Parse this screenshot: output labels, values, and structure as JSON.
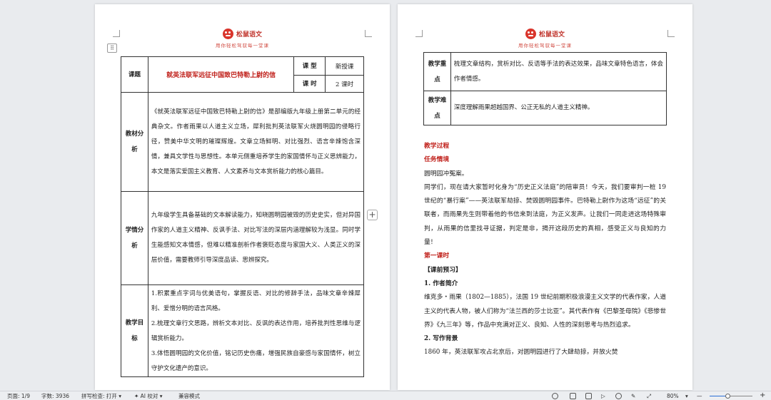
{
  "brand": {
    "name": "松鼠语文",
    "slogan": "用你轻松驾驭每一堂课"
  },
  "page1": {
    "title_label": "课题",
    "title": "就英法联军远征中国致巴特勒上尉的信",
    "type_label": "课 型",
    "type_value": "新授课",
    "hours_label": "课 时",
    "hours_value": "2 课时",
    "rows": [
      {
        "label_line1": "教材分",
        "label_line2": "析",
        "text": "《就英法联军远征中国致巴特勒上尉的信》是部编版九年级上册第二单元的经典杂文。作者雨果以人道主义立场，犀利批判英法联军火烧圆明园的侵略行径，赞美中华文明的璀璨辉煌。文章立场鲜明、对比强烈、语言辛辣饱含深情，兼具文学性与思想性。本单元侧重培养学生的家国情怀与正义思辨能力，本文是落实爱国主义教育、人文素养与文本赏析能力的核心篇目。"
      },
      {
        "label_line1": "学情分",
        "label_line2": "析",
        "text": "九年级学生具备基础的文本解读能力，知晓圆明园被毁的历史史实，但对异国作家的人道主义精神、反讽手法、对比写法的深层内涵理解较为浅显。同时学生能感知文本情感，但难以精准剖析作者褒贬态度与家国大义、人类正义的深层价值，需要教师引导深度品读、思辨探究。"
      },
      {
        "label_line1": "教学目",
        "label_line2": "标",
        "items": [
          "1.积累重点字词与优美语句，掌握反语、对比的修辞手法，品味文章辛辣犀利、爱憎分明的语言风格。",
          "2.梳理文章行文思路，辨析文本对比、反讽的表达作用，培养批判性思维与逻辑赏析能力。",
          "3.体悟圆明园的文化价值，铭记历史伤痛，增强民族自豪感与家国情怀，树立守护文化遗产的意识。"
        ]
      }
    ]
  },
  "page2": {
    "rows": [
      {
        "label_line1": "教学重",
        "label_line2": "点",
        "text": "梳理文章结构，赏析对比、反语等手法的表达效果，品味文章特色语言，体会作者情感。"
      },
      {
        "label_line1": "教学难",
        "label_line2": "点",
        "text": "深度理解雨果超越国界、公正无私的人道主义精神。"
      }
    ],
    "process_title": "教学过程",
    "task_heading": "任务情境",
    "task_subtitle": "圆明园冲冤案。",
    "task_text": "同学们，现在请大家暂时化身为“历史正义法庭”的陪审员！今天，我们要审判一桩 19 世纪的“暴行案”——英法联军劫掠、焚毁圆明园事件。巴特勒上尉作为这场“远征”的关联者，而雨果先生则带着他的书信来到法庭，为正义发声。让我们一同走进这场特殊审判，从雨果的信里找寻证据，判定是非，揭开这段历史的真相，感受正义与良知的力量！",
    "lesson1_title": "第一课时",
    "preview_heading": "【课前预习】",
    "author_heading": "1. 作者简介",
    "author_text": "维克多・雨果（1802—1885），法国 19 世纪前期积极浪漫主义文学的代表作家，人道主义的代表人物，被人们称为“法兰西的莎士比亚”。其代表作有《巴黎圣母院》《悲惨世界》《九三年》等，作品中充满对正义、良知、人性的深刻思考与热烈追求。",
    "background_heading": "2. 写作背景",
    "background_text": "1860 年，英法联军攻占北京后，对圆明园进行了大肆劫掠，并放火焚"
  },
  "status": {
    "page": "页面: 1/9",
    "words": "字数: 3936",
    "spell": "拼写检查: 打开",
    "ai": "AI 校对",
    "compat": "兼容模式",
    "zoom": "80%",
    "zoom_minus": "—",
    "zoom_plus": "+"
  }
}
